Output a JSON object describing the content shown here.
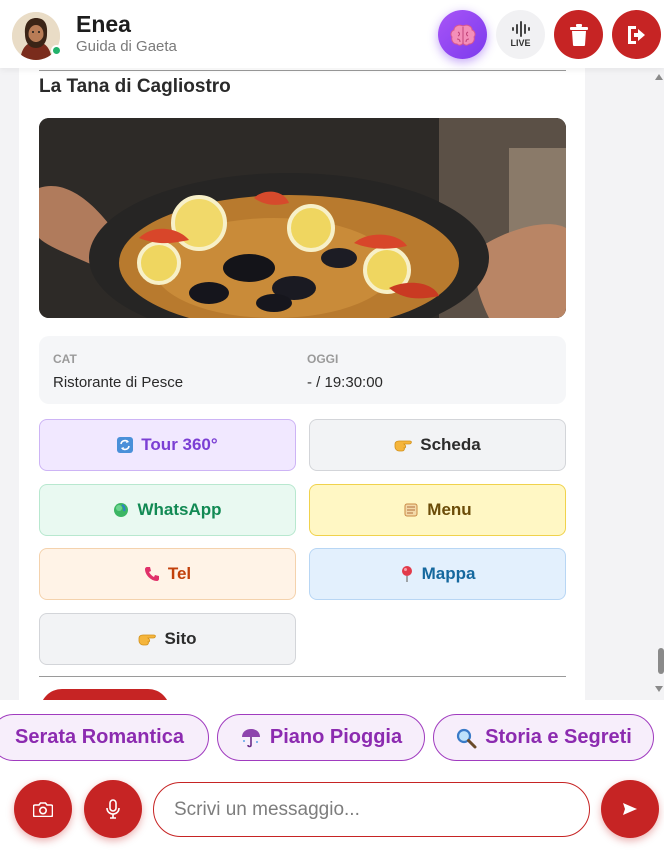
{
  "header": {
    "agent_name": "Enea",
    "agent_subtitle": "Guida di Gaeta",
    "live_label": "LIVE",
    "online_color": "#22b26b",
    "buttons": [
      {
        "name": "brain-mode-button",
        "icon": "brain-icon"
      },
      {
        "name": "live-button",
        "icon": "soundwave-icon"
      },
      {
        "name": "delete-chat-button",
        "icon": "trash-icon"
      },
      {
        "name": "logout-button",
        "icon": "exit-icon"
      }
    ]
  },
  "card": {
    "title": "La Tana di Cagliostro",
    "photo": "paella-seafood-photo",
    "info": {
      "cat_label": "CAT",
      "cat_value": "Ristorante di Pesce",
      "today_label": "OGGI",
      "today_value": "- / 19:30:00"
    },
    "actions": {
      "tour": {
        "label": "Tour 360°",
        "icon": "rotate-icon"
      },
      "scheda": {
        "label": "Scheda",
        "icon": "pointing-hand-icon"
      },
      "whatsapp": {
        "label": "WhatsApp",
        "icon": "green-circle-icon"
      },
      "menu": {
        "label": "Menu",
        "icon": "scroll-icon"
      },
      "tel": {
        "label": "Tel",
        "icon": "phone-icon"
      },
      "mappa": {
        "label": "Mappa",
        "icon": "pin-icon"
      },
      "sito": {
        "label": "Sito",
        "icon": "pointing-hand-icon"
      }
    }
  },
  "suggestions": [
    {
      "label": "Serata Romantica",
      "icon": ""
    },
    {
      "label": "Piano Pioggia",
      "icon": "umbrella-icon"
    },
    {
      "label": "Storia e Segreti",
      "icon": "magnifier-icon"
    }
  ],
  "composer": {
    "placeholder": "Scrivi un messaggio...",
    "camera_icon": "camera-icon",
    "mic_icon": "microphone-icon",
    "send_icon": "send-icon"
  },
  "colors": {
    "accent_red": "#c62424",
    "accent_purple": "#8c2bb0",
    "brain_gradient": "#a855f7"
  }
}
